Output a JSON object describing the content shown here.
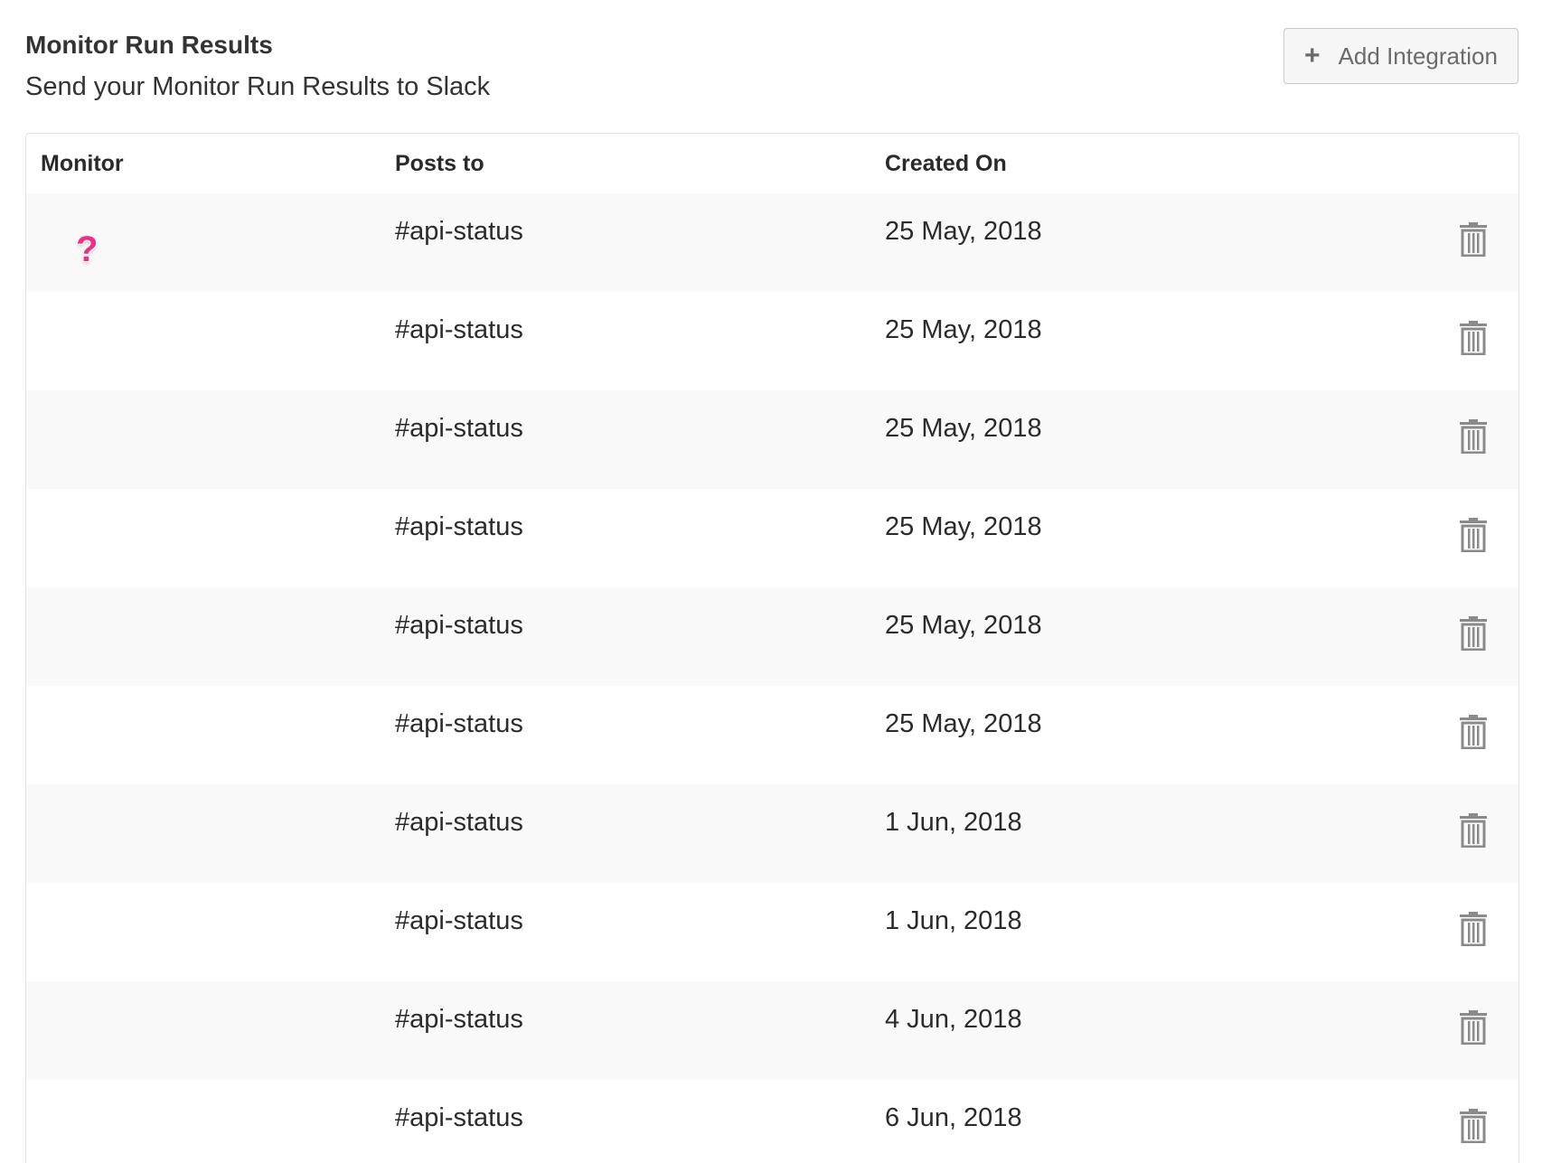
{
  "header": {
    "title": "Monitor Run Results",
    "subtitle": "Send your Monitor Run Results to Slack"
  },
  "toolbar": {
    "add_icon": "plus-icon",
    "add_label": "Add Integration"
  },
  "table": {
    "columns": [
      "Monitor",
      "Posts to",
      "Created On"
    ],
    "rows": [
      {
        "monitor_icon": "?",
        "posts_to": "#api-status",
        "created_on": "25 May, 2018"
      },
      {
        "monitor_icon": "",
        "posts_to": "#api-status",
        "created_on": "25 May, 2018"
      },
      {
        "monitor_icon": "",
        "posts_to": "#api-status",
        "created_on": "25 May, 2018"
      },
      {
        "monitor_icon": "",
        "posts_to": "#api-status",
        "created_on": "25 May, 2018"
      },
      {
        "monitor_icon": "",
        "posts_to": "#api-status",
        "created_on": "25 May, 2018"
      },
      {
        "monitor_icon": "",
        "posts_to": "#api-status",
        "created_on": "25 May, 2018"
      },
      {
        "monitor_icon": "",
        "posts_to": "#api-status",
        "created_on": "1 Jun, 2018"
      },
      {
        "monitor_icon": "",
        "posts_to": "#api-status",
        "created_on": "1 Jun, 2018"
      },
      {
        "monitor_icon": "",
        "posts_to": "#api-status",
        "created_on": "4 Jun, 2018"
      },
      {
        "monitor_icon": "",
        "posts_to": "#api-status",
        "created_on": "6 Jun, 2018"
      }
    ],
    "delete_icon": "trash-icon"
  },
  "colors": {
    "question_icon": "#f02e86",
    "row_alt_bg": "#f9f9f9",
    "trash_icon": "#8a8a8a"
  }
}
